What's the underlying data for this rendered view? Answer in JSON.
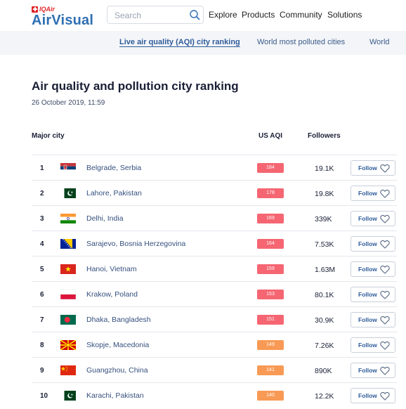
{
  "brand": {
    "iqair": "IQAir",
    "name": "AirVisual"
  },
  "search": {
    "placeholder": "Search"
  },
  "nav": [
    "Explore",
    "Products",
    "Community",
    "Solutions"
  ],
  "subnav": {
    "tabs": [
      "Live air quality (AQI) city ranking",
      "World most polluted cities",
      "World"
    ]
  },
  "page": {
    "title": "Air quality and pollution city ranking",
    "date": "26 October 2019, 11:59"
  },
  "table": {
    "headers": {
      "city": "Major city",
      "aqi": "US AQI",
      "followers": "Followers"
    },
    "follow_label": "Follow",
    "rows": [
      {
        "rank": "1",
        "city": "Belgrade, Serbia",
        "flag": "serbia-flag",
        "aqi": "184",
        "aqi_color": "#f56672",
        "followers": "19.1K"
      },
      {
        "rank": "2",
        "city": "Lahore, Pakistan",
        "flag": "pakistan-flag",
        "aqi": "178",
        "aqi_color": "#f56672",
        "followers": "19.8K"
      },
      {
        "rank": "3",
        "city": "Delhi, India",
        "flag": "india-flag",
        "aqi": "169",
        "aqi_color": "#f56672",
        "followers": "339K"
      },
      {
        "rank": "4",
        "city": "Sarajevo, Bosnia Herzegovina",
        "flag": "bosnia-flag",
        "aqi": "164",
        "aqi_color": "#f56672",
        "followers": "7.53K"
      },
      {
        "rank": "5",
        "city": "Hanoi, Vietnam",
        "flag": "vietnam-flag",
        "aqi": "159",
        "aqi_color": "#f56672",
        "followers": "1.63M"
      },
      {
        "rank": "6",
        "city": "Krakow, Poland",
        "flag": "poland-flag",
        "aqi": "153",
        "aqi_color": "#f56672",
        "followers": "80.1K"
      },
      {
        "rank": "7",
        "city": "Dhaka, Bangladesh",
        "flag": "bangladesh-flag",
        "aqi": "151",
        "aqi_color": "#f56672",
        "followers": "30.9K"
      },
      {
        "rank": "8",
        "city": "Skopje, Macedonia",
        "flag": "macedonia-flag",
        "aqi": "149",
        "aqi_color": "#f89a55",
        "followers": "7.26K"
      },
      {
        "rank": "9",
        "city": "Guangzhou, China",
        "flag": "china-flag",
        "aqi": "141",
        "aqi_color": "#f89a55",
        "followers": "890K"
      },
      {
        "rank": "10",
        "city": "Karachi, Pakistan",
        "flag": "pakistan-flag",
        "aqi": "140",
        "aqi_color": "#f89a55",
        "followers": "12.2K"
      }
    ]
  },
  "colors": {
    "brand_blue": "#2f6fb3",
    "aqi_unhealthy": "#f56672",
    "aqi_sensitive": "#f89a55"
  }
}
